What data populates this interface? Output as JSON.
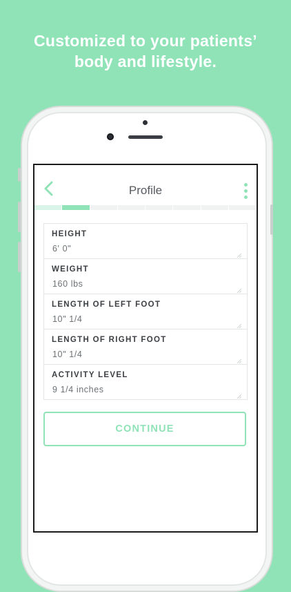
{
  "headline": {
    "line1": "Customized to your patients’",
    "line2": "body and lifestyle."
  },
  "navbar": {
    "title": "Profile",
    "back_icon": "chevron-left-icon",
    "more_icon": "vertical-dots-icon"
  },
  "progress": {
    "segments": 8,
    "completed": 1,
    "current": 2
  },
  "fields": [
    {
      "label": "HEIGHT",
      "value": "6' 0\""
    },
    {
      "label": "WEIGHT",
      "value": "160 lbs"
    },
    {
      "label": "LENGTH OF LEFT FOOT",
      "value": "10\" 1/4"
    },
    {
      "label": "LENGTH OF RIGHT FOOT",
      "value": "10\" 1/4"
    },
    {
      "label": "ACTIVITY LEVEL",
      "value": "9 1/4 inches"
    }
  ],
  "continue_label": "CONTINUE",
  "colors": {
    "accent": "#8fe3b7",
    "accent_light": "#d9f5e7",
    "text_dark": "#3c4044",
    "text_muted": "#6c7175"
  }
}
